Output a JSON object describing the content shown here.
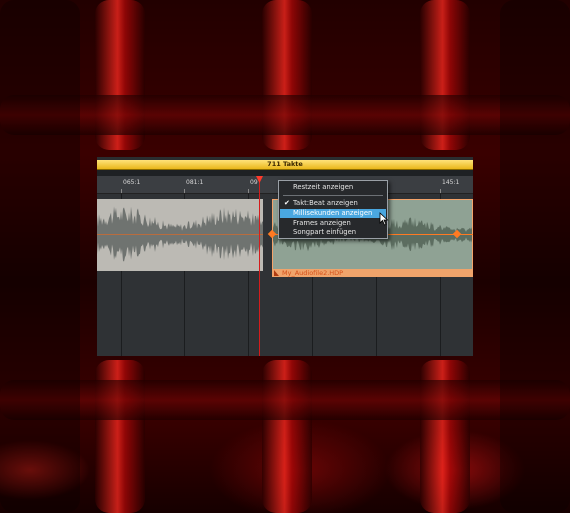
{
  "timeline": {
    "range_label": "711 Takte",
    "ruler_ticks": [
      "065:1",
      "081:1",
      "09",
      "145:1"
    ]
  },
  "clip": {
    "name": "My_Audiofile2.HDP"
  },
  "context_menu": {
    "items": [
      {
        "label": "Restzeit anzeigen",
        "checked": false,
        "highlighted": false
      },
      {
        "label": "Takt:Beat anzeigen",
        "checked": true,
        "highlighted": false
      },
      {
        "label": "Millisekunden anzeigen",
        "checked": false,
        "highlighted": true
      },
      {
        "label": "Frames anzeigen",
        "checked": false,
        "highlighted": false
      },
      {
        "label": "Songpart einfügen",
        "checked": false,
        "highlighted": false
      }
    ]
  },
  "colors": {
    "range_bar": "#e9b71a",
    "clip_border": "#f3a36a",
    "envelope": "#ff7a22",
    "playhead": "#d61c1c",
    "menu_highlight": "#4aa7e0"
  }
}
